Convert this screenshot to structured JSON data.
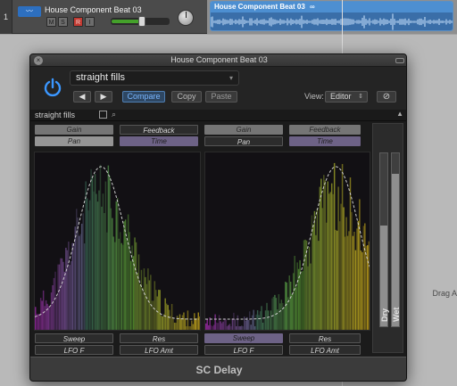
{
  "track": {
    "number": "1",
    "name": "House Component Beat 03",
    "buttons": [
      "M",
      "S",
      "R",
      "I"
    ],
    "volume_fraction": 0.55
  },
  "region": {
    "name": "House Component Beat 03",
    "loop_icon": "loop-icon"
  },
  "drag_hint": "Drag A",
  "plugin": {
    "window_title": "House Component Beat 03",
    "preset": "straight fills",
    "nav_prev": "◀",
    "nav_next": "▶",
    "compare": "Compare",
    "copy": "Copy",
    "paste": "Paste",
    "view_label": "View:",
    "view_value": "Editor",
    "preset_short": "straight fills",
    "left": {
      "gain": "Gain",
      "feedback": "Feedback",
      "pan": "Pan",
      "time": "Time",
      "sweep": "Sweep",
      "res": "Res",
      "lfo_f": "LFO F",
      "lfo_amt": "LFO Amt"
    },
    "right": {
      "gain": "Gain",
      "feedback": "Feedback",
      "pan": "Pan",
      "time": "Time",
      "sweep": "Sweep",
      "res": "Res",
      "lfo_f": "LFO F",
      "lfo_amt": "LFO Amt"
    },
    "dry_label": "Dry",
    "wet_label": "Wet",
    "dry_fraction": 0.58,
    "wet_fraction": 0.88,
    "footer": "SC Delay",
    "colors": {
      "accent_blue": "#3b97ff",
      "purple_param": "#6d6286",
      "compare_active": "#79b6ff"
    }
  }
}
